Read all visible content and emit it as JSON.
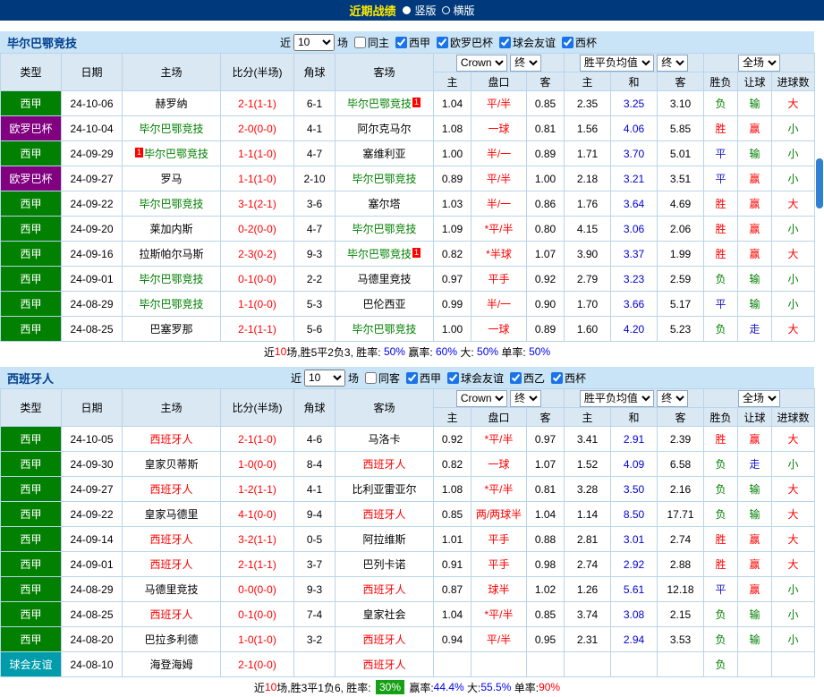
{
  "topbar": {
    "title": "近期战绩",
    "layout_options": [
      {
        "label": "竖版",
        "selected": true
      },
      {
        "label": "横版",
        "selected": false
      }
    ]
  },
  "league_colors": {
    "西甲": "#018001",
    "欧罗巴杯": "#800080",
    "球会友谊": "#009cab"
  },
  "value_colors": {
    "胜": "#ff0000",
    "平": "#1515c8",
    "负": "#008000",
    "赢": "#ff0000",
    "输": "#008000",
    "走": "#1515c8",
    "大": "#ff0000",
    "小": "#008000"
  },
  "sections": [
    {
      "team": "毕尔巴鄂竞技",
      "team_color": "#008000",
      "filter": {
        "prefix": "近",
        "count": "10",
        "suffix": "场",
        "checkboxes": [
          {
            "label": "同主",
            "checked": false
          },
          {
            "label": "西甲",
            "checked": true
          },
          {
            "label": "欧罗巴杯",
            "checked": true
          },
          {
            "label": "球会友谊",
            "checked": true
          },
          {
            "label": "西杯",
            "checked": true
          }
        ]
      },
      "table": {
        "static_cols": [
          "类型",
          "日期",
          "主场",
          "比分(半场)",
          "角球",
          "客场"
        ],
        "odds_selects": [
          "Crown",
          "终"
        ],
        "odds_cols": [
          "主",
          "盘口",
          "客"
        ],
        "europe_selects": [
          "胜平负均值",
          "终"
        ],
        "europe_cols": [
          "主",
          "和",
          "客"
        ],
        "scope_select": "全场",
        "result_cols": [
          "胜负",
          "让球",
          "进球数"
        ],
        "rows": [
          {
            "league": "西甲",
            "date": "24-10-06",
            "home": "赫罗纳",
            "score": "2-1(1-1)",
            "corner": "6-1",
            "away": "毕尔巴鄂竞技",
            "away_is_team": true,
            "away_badge": "1",
            "odds": [
              "1.04",
              "平/半",
              "0.85"
            ],
            "avg": [
              "2.35",
              "3.25",
              "3.10"
            ],
            "result": [
              "负",
              "输",
              "大"
            ]
          },
          {
            "league": "欧罗巴杯",
            "date": "24-10-04",
            "home": "毕尔巴鄂竞技",
            "home_is_team": true,
            "score": "2-0(0-0)",
            "corner": "4-1",
            "away": "阿尔克马尔",
            "odds": [
              "1.08",
              "一球",
              "0.81"
            ],
            "avg": [
              "1.56",
              "4.06",
              "5.85"
            ],
            "result": [
              "胜",
              "赢",
              "小"
            ]
          },
          {
            "league": "西甲",
            "date": "24-09-29",
            "home": "毕尔巴鄂竞技",
            "home_is_team": true,
            "home_badge": "1",
            "home_badge_pos": "before",
            "score": "1-1(1-0)",
            "corner": "4-7",
            "away": "塞维利亚",
            "odds": [
              "1.00",
              "半/一",
              "0.89"
            ],
            "avg": [
              "1.71",
              "3.70",
              "5.01"
            ],
            "result": [
              "平",
              "输",
              "小"
            ]
          },
          {
            "league": "欧罗巴杯",
            "date": "24-09-27",
            "home": "罗马",
            "score": "1-1(1-0)",
            "corner": "2-10",
            "away": "毕尔巴鄂竞技",
            "away_is_team": true,
            "odds": [
              "0.89",
              "平/半",
              "1.00"
            ],
            "avg": [
              "2.18",
              "3.21",
              "3.51"
            ],
            "result": [
              "平",
              "赢",
              "小"
            ]
          },
          {
            "league": "西甲",
            "date": "24-09-22",
            "home": "毕尔巴鄂竞技",
            "home_is_team": true,
            "score": "3-1(2-1)",
            "corner": "3-6",
            "away": "塞尔塔",
            "odds": [
              "1.03",
              "半/一",
              "0.86"
            ],
            "avg": [
              "1.76",
              "3.64",
              "4.69"
            ],
            "result": [
              "胜",
              "赢",
              "大"
            ]
          },
          {
            "league": "西甲",
            "date": "24-09-20",
            "home": "莱加内斯",
            "score": "0-2(0-0)",
            "corner": "4-7",
            "away": "毕尔巴鄂竞技",
            "away_is_team": true,
            "odds": [
              "1.09",
              "*平/半",
              "0.80"
            ],
            "avg": [
              "4.15",
              "3.06",
              "2.06"
            ],
            "result": [
              "胜",
              "赢",
              "小"
            ]
          },
          {
            "league": "西甲",
            "date": "24-09-16",
            "home": "拉斯帕尔马斯",
            "score": "2-3(0-2)",
            "corner": "9-3",
            "away": "毕尔巴鄂竞技",
            "away_is_team": true,
            "away_badge": "1",
            "odds": [
              "0.82",
              "*半球",
              "1.07"
            ],
            "avg": [
              "3.90",
              "3.37",
              "1.99"
            ],
            "result": [
              "胜",
              "赢",
              "大"
            ]
          },
          {
            "league": "西甲",
            "date": "24-09-01",
            "home": "毕尔巴鄂竞技",
            "home_is_team": true,
            "score": "0-1(0-0)",
            "corner": "2-2",
            "away": "马德里竞技",
            "odds": [
              "0.97",
              "平手",
              "0.92"
            ],
            "avg": [
              "2.79",
              "3.23",
              "2.59"
            ],
            "result": [
              "负",
              "输",
              "小"
            ]
          },
          {
            "league": "西甲",
            "date": "24-08-29",
            "home": "毕尔巴鄂竞技",
            "home_is_team": true,
            "score": "1-1(0-0)",
            "corner": "5-3",
            "away": "巴伦西亚",
            "odds": [
              "0.99",
              "半/一",
              "0.90"
            ],
            "avg": [
              "1.70",
              "3.66",
              "5.17"
            ],
            "result": [
              "平",
              "输",
              "小"
            ]
          },
          {
            "league": "西甲",
            "date": "24-08-25",
            "home": "巴塞罗那",
            "score": "2-1(1-1)",
            "corner": "5-6",
            "away": "毕尔巴鄂竞技",
            "away_is_team": true,
            "odds": [
              "1.00",
              "一球",
              "0.89"
            ],
            "avg": [
              "1.60",
              "4.20",
              "5.23"
            ],
            "result": [
              "负",
              "走",
              "大"
            ]
          }
        ]
      },
      "footer": [
        {
          "t": "近",
          "c": "#000000"
        },
        {
          "t": "10",
          "c": "#ff0000"
        },
        {
          "t": "场,胜5平2负3, 胜率: ",
          "c": "#000000"
        },
        {
          "t": "50%",
          "c": "#0000ee"
        },
        {
          "t": " 赢率: ",
          "c": "#000000"
        },
        {
          "t": "60%",
          "c": "#0000ee"
        },
        {
          "t": " 大: ",
          "c": "#000000"
        },
        {
          "t": "50%",
          "c": "#0000ee"
        },
        {
          "t": " 单率: ",
          "c": "#000000"
        },
        {
          "t": "50%",
          "c": "#0000ee"
        }
      ]
    },
    {
      "team": "西班牙人",
      "team_color": "#ff0000",
      "filter": {
        "prefix": "近",
        "count": "10",
        "suffix": "场",
        "checkboxes": [
          {
            "label": "同客",
            "checked": false
          },
          {
            "label": "西甲",
            "checked": true
          },
          {
            "label": "球会友谊",
            "checked": true
          },
          {
            "label": "西乙",
            "checked": true
          },
          {
            "label": "西杯",
            "checked": true
          }
        ]
      },
      "table": {
        "static_cols": [
          "类型",
          "日期",
          "主场",
          "比分(半场)",
          "角球",
          "客场"
        ],
        "odds_selects": [
          "Crown",
          "终"
        ],
        "odds_cols": [
          "主",
          "盘口",
          "客"
        ],
        "europe_selects": [
          "胜平负均值",
          "终"
        ],
        "europe_cols": [
          "主",
          "和",
          "客"
        ],
        "scope_select": "全场",
        "result_cols": [
          "胜负",
          "让球",
          "进球数"
        ],
        "rows": [
          {
            "league": "西甲",
            "date": "24-10-05",
            "home": "西班牙人",
            "home_is_team": true,
            "score": "2-1(1-0)",
            "corner": "4-6",
            "away": "马洛卡",
            "odds": [
              "0.92",
              "*平/半",
              "0.97"
            ],
            "avg": [
              "3.41",
              "2.91",
              "2.39"
            ],
            "result": [
              "胜",
              "赢",
              "大"
            ]
          },
          {
            "league": "西甲",
            "date": "24-09-30",
            "home": "皇家贝蒂斯",
            "score": "1-0(0-0)",
            "corner": "8-4",
            "away": "西班牙人",
            "away_is_team": true,
            "odds": [
              "0.82",
              "一球",
              "1.07"
            ],
            "avg": [
              "1.52",
              "4.09",
              "6.58"
            ],
            "result": [
              "负",
              "走",
              "小"
            ]
          },
          {
            "league": "西甲",
            "date": "24-09-27",
            "home": "西班牙人",
            "home_is_team": true,
            "score": "1-2(1-1)",
            "corner": "4-1",
            "away": "比利亚雷亚尔",
            "odds": [
              "1.08",
              "*平/半",
              "0.81"
            ],
            "avg": [
              "3.28",
              "3.50",
              "2.16"
            ],
            "result": [
              "负",
              "输",
              "大"
            ]
          },
          {
            "league": "西甲",
            "date": "24-09-22",
            "home": "皇家马德里",
            "score": "4-1(0-0)",
            "corner": "9-4",
            "away": "西班牙人",
            "away_is_team": true,
            "odds": [
              "0.85",
              "两/两球半",
              "1.04"
            ],
            "avg": [
              "1.14",
              "8.50",
              "17.71"
            ],
            "result": [
              "负",
              "输",
              "大"
            ]
          },
          {
            "league": "西甲",
            "date": "24-09-14",
            "home": "西班牙人",
            "home_is_team": true,
            "score": "3-2(1-1)",
            "corner": "0-5",
            "away": "阿拉维斯",
            "odds": [
              "1.01",
              "平手",
              "0.88"
            ],
            "avg": [
              "2.81",
              "3.01",
              "2.74"
            ],
            "result": [
              "胜",
              "赢",
              "大"
            ]
          },
          {
            "league": "西甲",
            "date": "24-09-01",
            "home": "西班牙人",
            "home_is_team": true,
            "score": "2-1(1-1)",
            "corner": "3-7",
            "away": "巴列卡诺",
            "odds": [
              "0.91",
              "平手",
              "0.98"
            ],
            "avg": [
              "2.74",
              "2.92",
              "2.88"
            ],
            "result": [
              "胜",
              "赢",
              "大"
            ]
          },
          {
            "league": "西甲",
            "date": "24-08-29",
            "home": "马德里竞技",
            "score": "0-0(0-0)",
            "corner": "9-3",
            "away": "西班牙人",
            "away_is_team": true,
            "odds": [
              "0.87",
              "球半",
              "1.02"
            ],
            "avg": [
              "1.26",
              "5.61",
              "12.18"
            ],
            "result": [
              "平",
              "赢",
              "小"
            ]
          },
          {
            "league": "西甲",
            "date": "24-08-25",
            "home": "西班牙人",
            "home_is_team": true,
            "score": "0-1(0-0)",
            "corner": "7-4",
            "away": "皇家社会",
            "odds": [
              "1.04",
              "*平/半",
              "0.85"
            ],
            "avg": [
              "3.74",
              "3.08",
              "2.15"
            ],
            "result": [
              "负",
              "输",
              "小"
            ]
          },
          {
            "league": "西甲",
            "date": "24-08-20",
            "home": "巴拉多利德",
            "score": "1-0(1-0)",
            "corner": "3-2",
            "away": "西班牙人",
            "away_is_team": true,
            "odds": [
              "0.94",
              "平/半",
              "0.95"
            ],
            "avg": [
              "2.31",
              "2.94",
              "3.53"
            ],
            "result": [
              "负",
              "输",
              "小"
            ]
          },
          {
            "league": "球会友谊",
            "date": "24-08-10",
            "home": "海登海姆",
            "score": "2-1(0-0)",
            "corner": "",
            "away": "西班牙人",
            "away_is_team": true,
            "odds": [
              "",
              "",
              ""
            ],
            "avg": [
              "",
              "",
              ""
            ],
            "result": [
              "负",
              "",
              ""
            ]
          }
        ]
      },
      "footer": [
        {
          "t": "近",
          "c": "#000000"
        },
        {
          "t": "10",
          "c": "#ff0000"
        },
        {
          "t": "场,胜3平1负6, 胜率: ",
          "c": "#000000"
        },
        {
          "t": "30%",
          "c": "badge"
        },
        {
          "t": " 赢率:",
          "c": "#000000"
        },
        {
          "t": "44.4%",
          "c": "#0000ee"
        },
        {
          "t": " 大:",
          "c": "#000000"
        },
        {
          "t": "55.5%",
          "c": "#0000ee"
        },
        {
          "t": " 单率:",
          "c": "#000000"
        },
        {
          "t": "90%",
          "c": "#ff0000"
        }
      ]
    }
  ]
}
